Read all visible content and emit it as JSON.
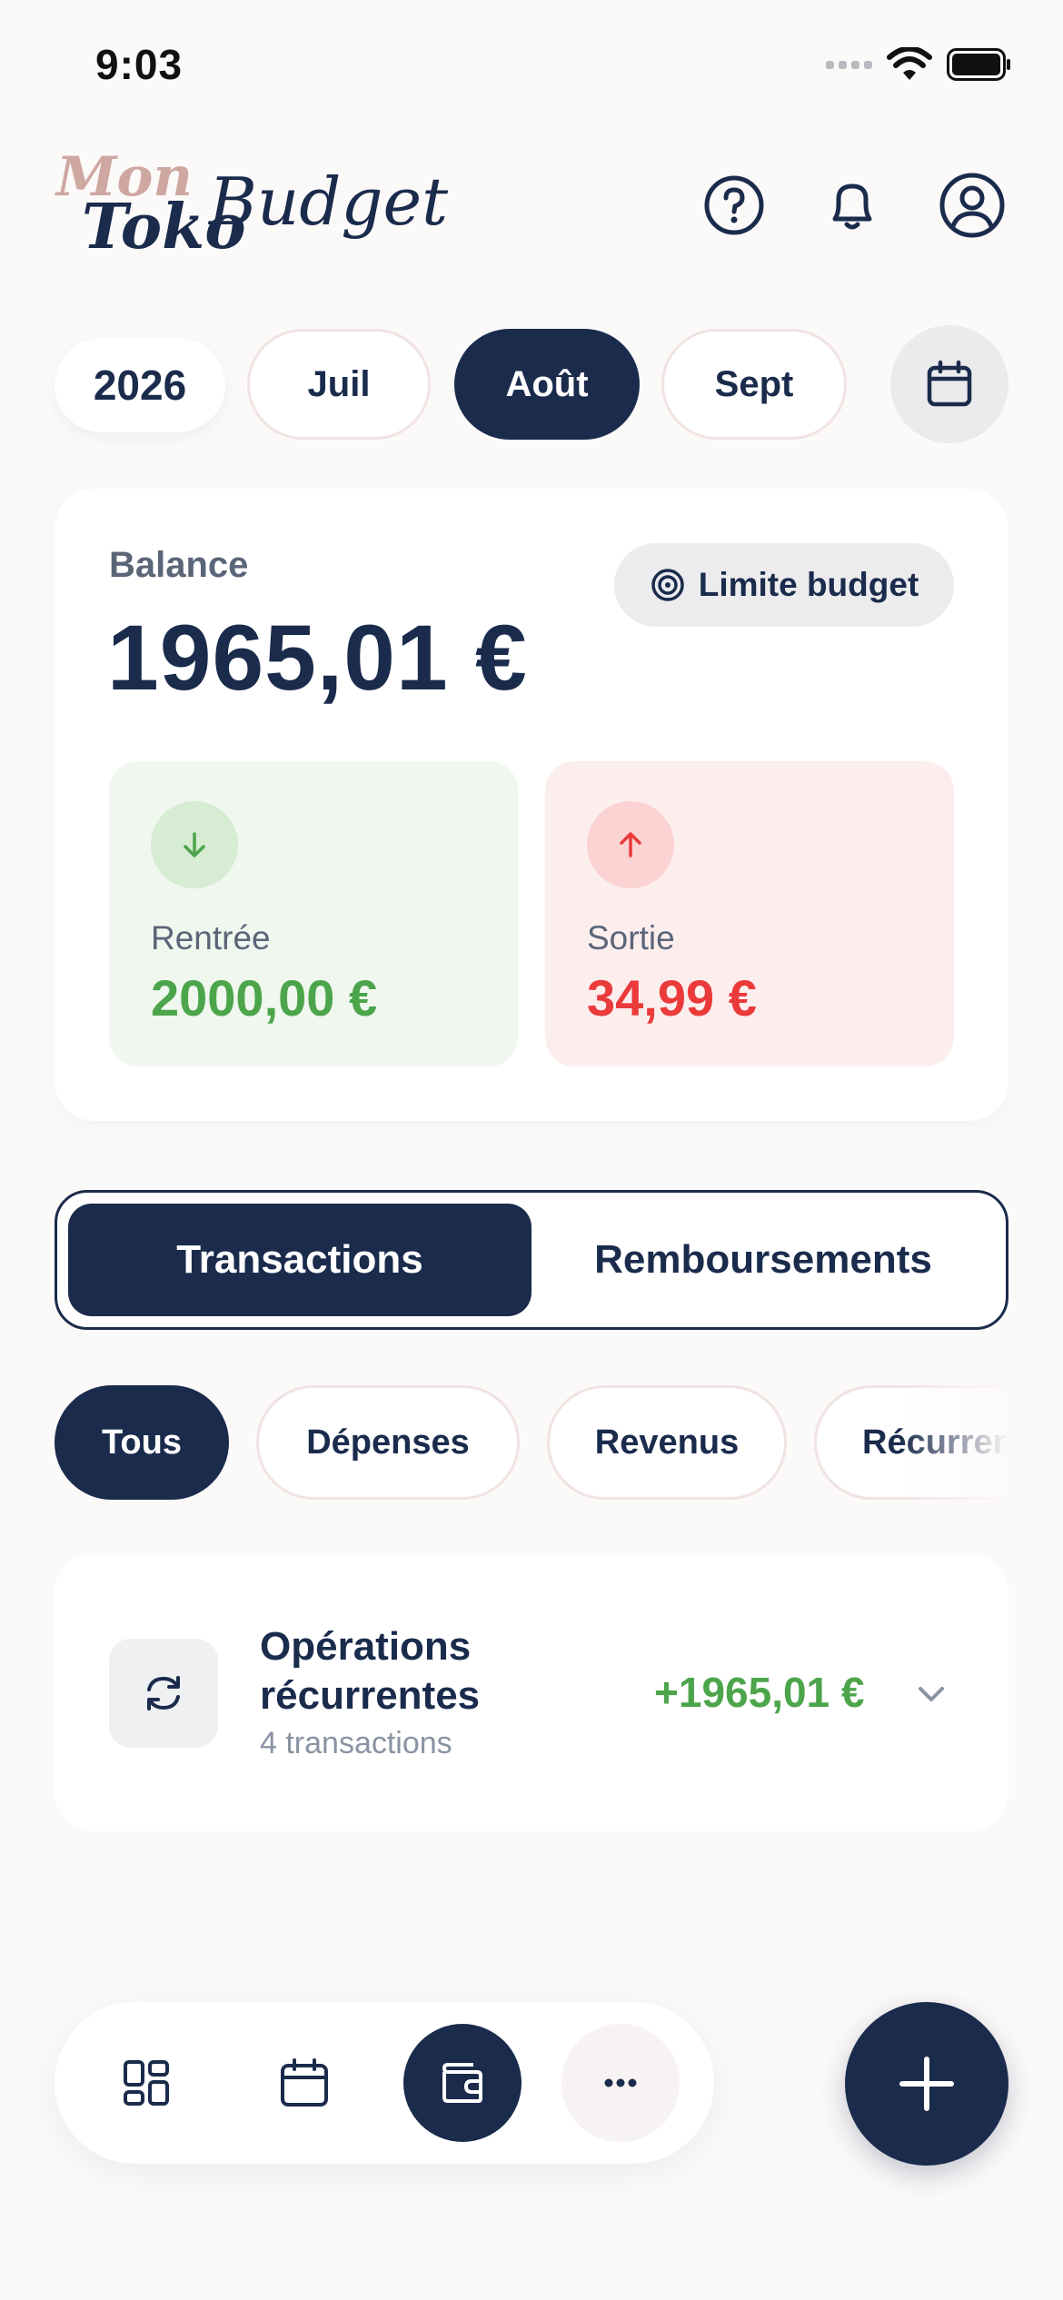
{
  "status_bar": {
    "time": "9:03"
  },
  "header": {
    "logo": {
      "line1": "Mon",
      "line2": "Toko",
      "line3": "Budget"
    },
    "icons": [
      "help-circle-icon",
      "bell-icon",
      "user-circle-icon"
    ]
  },
  "period": {
    "year": "2026",
    "months": [
      {
        "label": "Juil",
        "active": false
      },
      {
        "label": "Août",
        "active": true
      },
      {
        "label": "Sept",
        "active": false
      }
    ],
    "calendar_icon": "calendar-icon"
  },
  "balance": {
    "label": "Balance",
    "value": "1965,01 €",
    "limit_button": "Limite budget",
    "income": {
      "label": "Rentrée",
      "value": "2000,00 €"
    },
    "expense": {
      "label": "Sortie",
      "value": "34,99 €"
    }
  },
  "segment": {
    "active": "Transactions",
    "other": "Remboursements"
  },
  "filters": [
    "Tous",
    "Dépenses",
    "Revenus",
    "Récurrents"
  ],
  "recurring": {
    "title": "Opérations récurrentes",
    "subtitle": "4 transactions",
    "amount": "+1965,01 €"
  },
  "colors": {
    "primary": "#1a2b4c",
    "income": "#4ca54a",
    "expense": "#ea3a3a",
    "logo_accent": "#cfa7a1"
  }
}
